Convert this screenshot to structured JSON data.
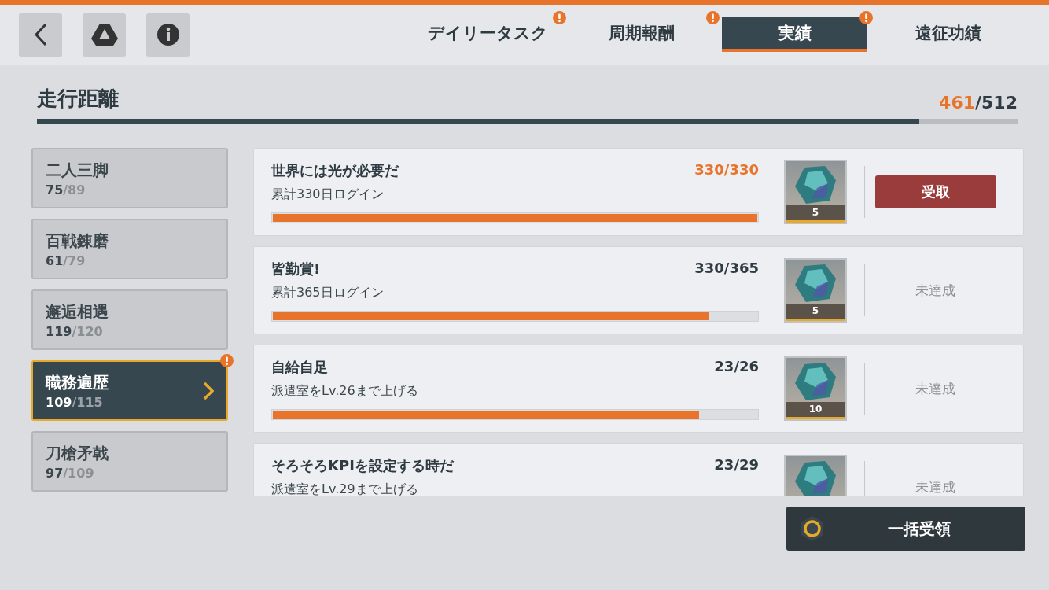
{
  "tabs": [
    {
      "label": "デイリータスク",
      "selected": false,
      "alert": true
    },
    {
      "label": "周期報酬",
      "selected": false,
      "alert": true
    },
    {
      "label": "実績",
      "selected": true,
      "alert": true
    },
    {
      "label": "遠征功績",
      "selected": false,
      "alert": false
    }
  ],
  "section": {
    "title": "走行距離",
    "current": "461",
    "total": "/512",
    "level": 0.9
  },
  "categories": [
    {
      "name": "二人三脚",
      "current": "75",
      "total": "/89",
      "selected": false,
      "alert": false
    },
    {
      "name": "百戦錬磨",
      "current": "61",
      "total": "/79",
      "selected": false,
      "alert": false
    },
    {
      "name": "邂逅相遇",
      "current": "119",
      "total": "/120",
      "selected": false,
      "alert": false
    },
    {
      "name": "職務遍歴",
      "current": "109",
      "total": "/115",
      "selected": true,
      "alert": true
    },
    {
      "name": "刀槍矛戟",
      "current": "97",
      "total": "/109",
      "selected": false,
      "alert": false
    }
  ],
  "achievements": [
    {
      "title": "世界には光が必要だ",
      "progress": "330/330",
      "complete": true,
      "description": "累計330日ログイン",
      "level": 1,
      "reward": "5",
      "kind": "claim",
      "status": "受取"
    },
    {
      "title": "皆勤賞!",
      "progress": "330/365",
      "complete": false,
      "description": "累計365日ログイン",
      "level": 0.9,
      "reward": "5",
      "kind": "locked",
      "status": "未達成"
    },
    {
      "title": "自給自足",
      "progress": "23/26",
      "complete": false,
      "description": "派遣室をLv.26まで上げる",
      "level": 0.88,
      "reward": "10",
      "kind": "locked",
      "status": "未達成"
    },
    {
      "title": "そろそろKPIを設定する時だ",
      "progress": "23/29",
      "complete": false,
      "description": "派遣室をLv.29まで上げる",
      "kind": "locked",
      "status": "未達成"
    }
  ],
  "claim_all": {
    "label": "一括受領"
  }
}
